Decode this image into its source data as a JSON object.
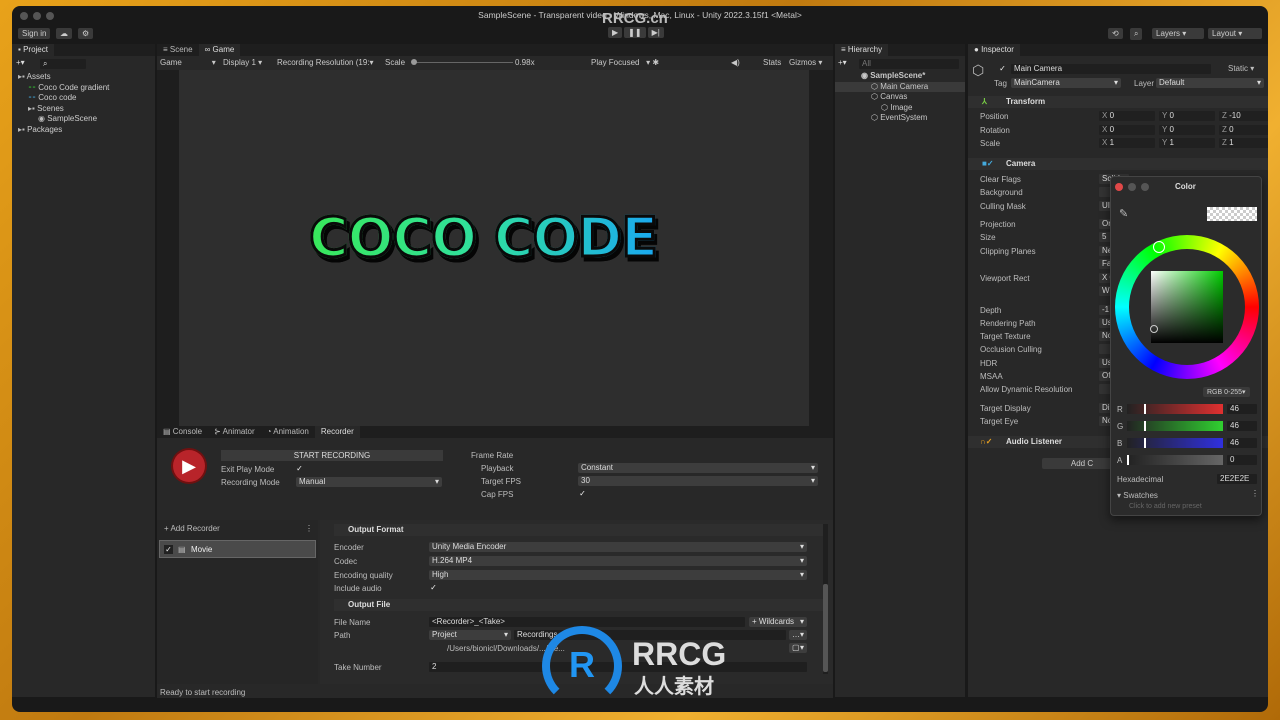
{
  "window": {
    "title": "SampleScene - Transparent video - Windows, Mac, Linux - Unity 2022.3.15f1 <Metal>"
  },
  "toolbar": {
    "sign_in": "Sign in",
    "layers": "Layers",
    "layout": "Layout"
  },
  "project": {
    "tab": "Project",
    "tree": [
      {
        "label": "Assets",
        "level": 0
      },
      {
        "label": "Coco Code gradient",
        "level": 1
      },
      {
        "label": "Coco code",
        "level": 1
      },
      {
        "label": "Scenes",
        "level": 1
      },
      {
        "label": "SampleScene",
        "level": 2
      },
      {
        "label": "Packages",
        "level": 0
      }
    ]
  },
  "game": {
    "tabs": [
      "Scene",
      "Game"
    ],
    "display_mode": "Game",
    "display": "Display 1",
    "resolution": "Recording Resolution (19:",
    "scale_label": "Scale",
    "scale_value": "0.98x",
    "play_focused": "Play Focused",
    "stats": "Stats",
    "gizmos": "Gizmos",
    "logo_text": "COCO CODE"
  },
  "bottom": {
    "tabs": [
      "Console",
      "Animator",
      "Animation",
      "Recorder"
    ],
    "start_recording": "START RECORDING",
    "exit_play_mode": "Exit Play Mode",
    "recording_mode_label": "Recording Mode",
    "recording_mode": "Manual",
    "frame_rate": "Frame Rate",
    "playback_label": "Playback",
    "playback": "Constant",
    "target_fps_label": "Target FPS",
    "target_fps": "30",
    "cap_fps": "Cap FPS",
    "add_recorder": "+ Add Recorder",
    "recorder_item": "Movie",
    "output_format": "Output Format",
    "encoder_label": "Encoder",
    "encoder": "Unity Media Encoder",
    "codec_label": "Codec",
    "codec": "H.264 MP4",
    "quality_label": "Encoding quality",
    "quality": "High",
    "include_audio": "Include audio",
    "output_file": "Output File",
    "file_name_label": "File Name",
    "file_name": "<Recorder>_<Take>",
    "wildcards": "+ Wildcards",
    "path_label": "Path",
    "path_root": "Project",
    "path_folder": "Recordings",
    "full_path": "/Users/bionicl/Downloads/.../Re...",
    "take_label": "Take Number",
    "take": "2",
    "status": "Ready to start recording"
  },
  "hierarchy": {
    "tab": "Hierarchy",
    "search_placeholder": "All",
    "items": [
      {
        "label": "SampleScene*",
        "level": 0
      },
      {
        "label": "Main Camera",
        "level": 1
      },
      {
        "label": "Canvas",
        "level": 1
      },
      {
        "label": "Image",
        "level": 2
      },
      {
        "label": "EventSystem",
        "level": 1
      }
    ]
  },
  "inspector": {
    "tab": "Inspector",
    "object_name": "Main Camera",
    "static": "Static",
    "tag_label": "Tag",
    "tag": "MainCamera",
    "layer_label": "Layer",
    "layer": "Default",
    "transform": {
      "title": "Transform",
      "rows": [
        {
          "label": "Position",
          "x": "0",
          "y": "0",
          "z": "-10"
        },
        {
          "label": "Rotation",
          "x": "0",
          "y": "0",
          "z": "0"
        },
        {
          "label": "Scale",
          "x": "1",
          "y": "1",
          "z": "1"
        }
      ]
    },
    "camera": {
      "title": "Camera",
      "props": [
        {
          "label": "Clear Flags",
          "value": "Solid"
        },
        {
          "label": "Background",
          "value": ""
        },
        {
          "label": "Culling Mask",
          "value": "UI"
        },
        {
          "label": "Projection",
          "value": "Ortho"
        },
        {
          "label": "Size",
          "value": "5"
        },
        {
          "label": "Clipping Planes",
          "value": "Near"
        },
        {
          "label": "",
          "value": "Far"
        },
        {
          "label": "Viewport Rect",
          "value": "X 0"
        },
        {
          "label": "",
          "value": "W 1"
        },
        {
          "label": "Depth",
          "value": "-1"
        },
        {
          "label": "Rendering Path",
          "value": "Use"
        },
        {
          "label": "Target Texture",
          "value": "None"
        },
        {
          "label": "Occlusion Culling",
          "value": ""
        },
        {
          "label": "HDR",
          "value": "Use"
        },
        {
          "label": "MSAA",
          "value": "Off"
        },
        {
          "label": "Allow Dynamic Resolution",
          "value": ""
        },
        {
          "label": "Target Display",
          "value": "Disp"
        },
        {
          "label": "Target Eye",
          "value": "None"
        }
      ]
    },
    "audio_listener": "Audio Listener",
    "add_component": "Add C"
  },
  "color_picker": {
    "title": "Color",
    "mode": "RGB 0-255",
    "r": "46",
    "g": "46",
    "b": "46",
    "a": "0",
    "hex_label": "Hexadecimal",
    "hex": "2E2E2E",
    "swatches": "Swatches",
    "swatch_hint": "Click to add new preset"
  },
  "watermark": {
    "text": "RRCG",
    "sub": "人人素材",
    "top": "RRCG.cn"
  },
  "colors": {
    "accent_red": "#c0392b",
    "panel": "#282828"
  }
}
